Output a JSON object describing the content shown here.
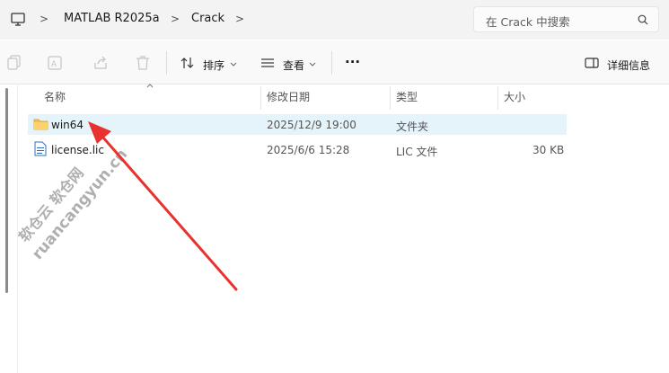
{
  "breadcrumb": {
    "items": [
      "MATLAB R2025a",
      "Crack"
    ],
    "separator": ">"
  },
  "search": {
    "placeholder": "在 Crack 中搜索"
  },
  "toolbar": {
    "sort_label": "排序",
    "view_label": "查看",
    "more_label": "···",
    "details_label": "详细信息"
  },
  "columns": {
    "name": "名称",
    "modified": "修改日期",
    "type": "类型",
    "size": "大小"
  },
  "files": [
    {
      "name": "win64",
      "modified": "2025/12/9 19:00",
      "type": "文件夹",
      "size": "",
      "selected": true,
      "icon": "folder-icon"
    },
    {
      "name": "license.lic",
      "modified": "2025/6/6 15:28",
      "type": "LIC 文件",
      "size": "30 KB",
      "selected": false,
      "icon": "document-icon"
    }
  ],
  "watermark": {
    "line1": "软仓云 软仓网",
    "line2": "ruancangyun.cn"
  },
  "colors": {
    "selection": "#e5f3fb",
    "arrow": "#e8322f",
    "folder": "#f5c04a"
  }
}
